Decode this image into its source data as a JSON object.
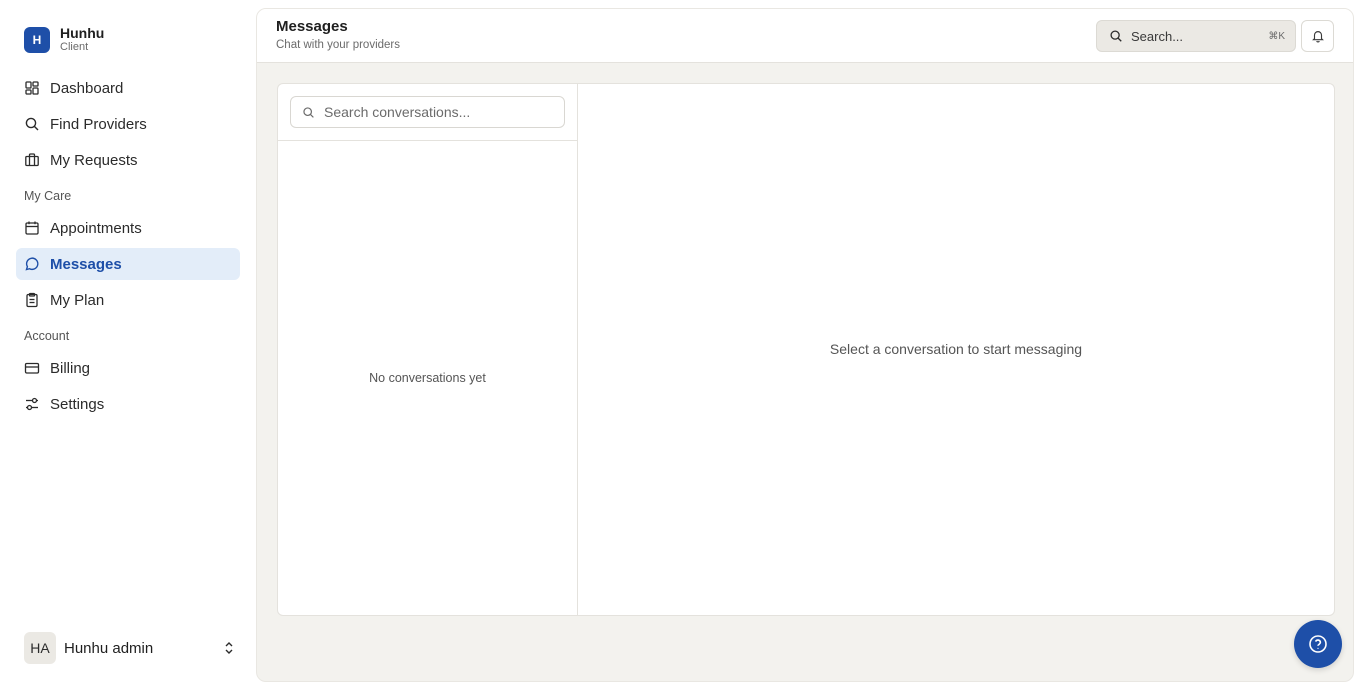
{
  "brand": {
    "logo_letter": "H",
    "name": "Hunhu",
    "role": "Client",
    "color": "#1e4fa8"
  },
  "sidebar": {
    "items": [
      {
        "label": "Dashboard",
        "icon": "dashboard-icon"
      },
      {
        "label": "Find Providers",
        "icon": "search-icon"
      },
      {
        "label": "My Requests",
        "icon": "briefcase-icon"
      }
    ],
    "section_care": "My Care",
    "care_items": [
      {
        "label": "Appointments",
        "icon": "calendar-icon"
      },
      {
        "label": "Messages",
        "icon": "message-circle-icon",
        "active": true
      },
      {
        "label": "My Plan",
        "icon": "clipboard-icon"
      }
    ],
    "section_account": "Account",
    "account_items": [
      {
        "label": "Billing",
        "icon": "credit-card-icon"
      },
      {
        "label": "Settings",
        "icon": "sliders-icon"
      }
    ]
  },
  "user": {
    "initials": "HA",
    "name": "Hunhu admin"
  },
  "header": {
    "title": "Messages",
    "subtitle": "Chat with your providers",
    "search_placeholder": "Search...",
    "search_shortcut": "⌘K"
  },
  "conversations": {
    "search_placeholder": "Search conversations...",
    "empty_text": "No conversations yet"
  },
  "chat": {
    "placeholder": "Select a conversation to start messaging"
  },
  "colors": {
    "accent": "#1e4fa8",
    "active_bg": "#e3edf9",
    "panel_bg": "#f3f2ee"
  }
}
